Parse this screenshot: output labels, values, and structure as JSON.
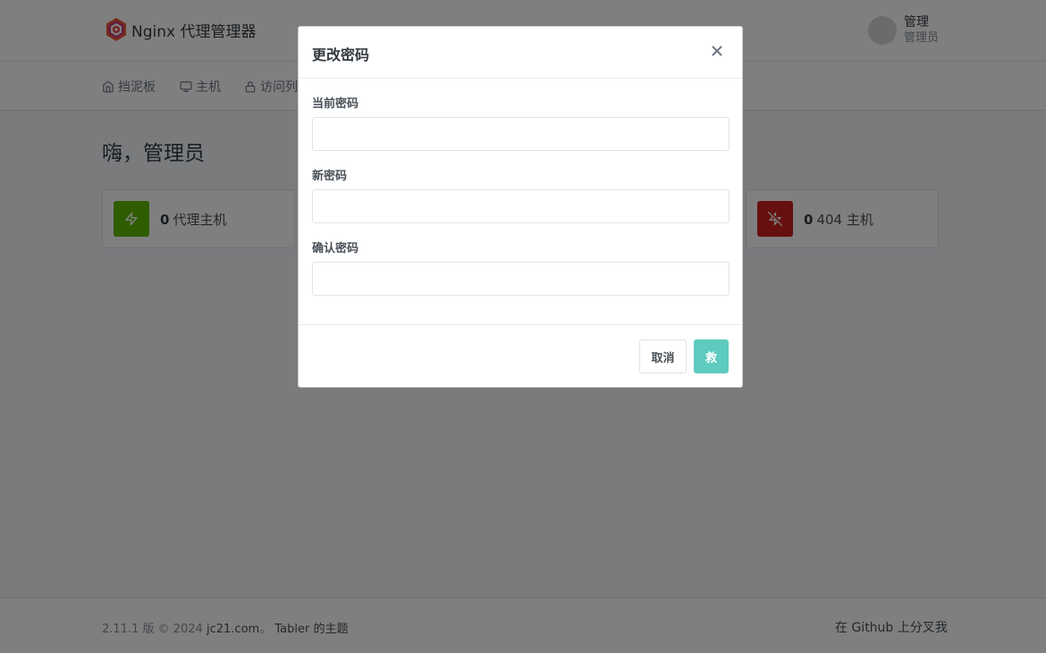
{
  "header": {
    "brand_title": "Nginx 代理管理器",
    "user_name": "管理",
    "user_role": "管理员"
  },
  "nav": {
    "items": [
      {
        "label": "挡泥板",
        "icon": "home-icon"
      },
      {
        "label": "主机",
        "icon": "monitor-icon"
      },
      {
        "label": "访问列",
        "icon": "lock-icon"
      }
    ]
  },
  "page": {
    "greeting": "嗨，管理员"
  },
  "stats": {
    "proxy_hosts": {
      "count": "0",
      "label": "代理主机",
      "color": "#5eba00"
    },
    "not_found_hosts": {
      "count": "0",
      "label": "404 主机",
      "color": "#cd201f"
    }
  },
  "modal": {
    "title": "更改密码",
    "fields": {
      "current_password": {
        "label": "当前密码",
        "value": ""
      },
      "new_password": {
        "label": "新密码",
        "value": ""
      },
      "confirm_password": {
        "label": "确认密码",
        "value": ""
      }
    },
    "cancel_label": "取消",
    "save_label": "救",
    "save_color": "#5dcbbd"
  },
  "footer": {
    "version": "2.11.1 版 © 2024",
    "author_link": "jc21.com",
    "separator": "。",
    "theme_text": "Tabler 的主题",
    "github_text": "在 Github 上分叉我"
  }
}
